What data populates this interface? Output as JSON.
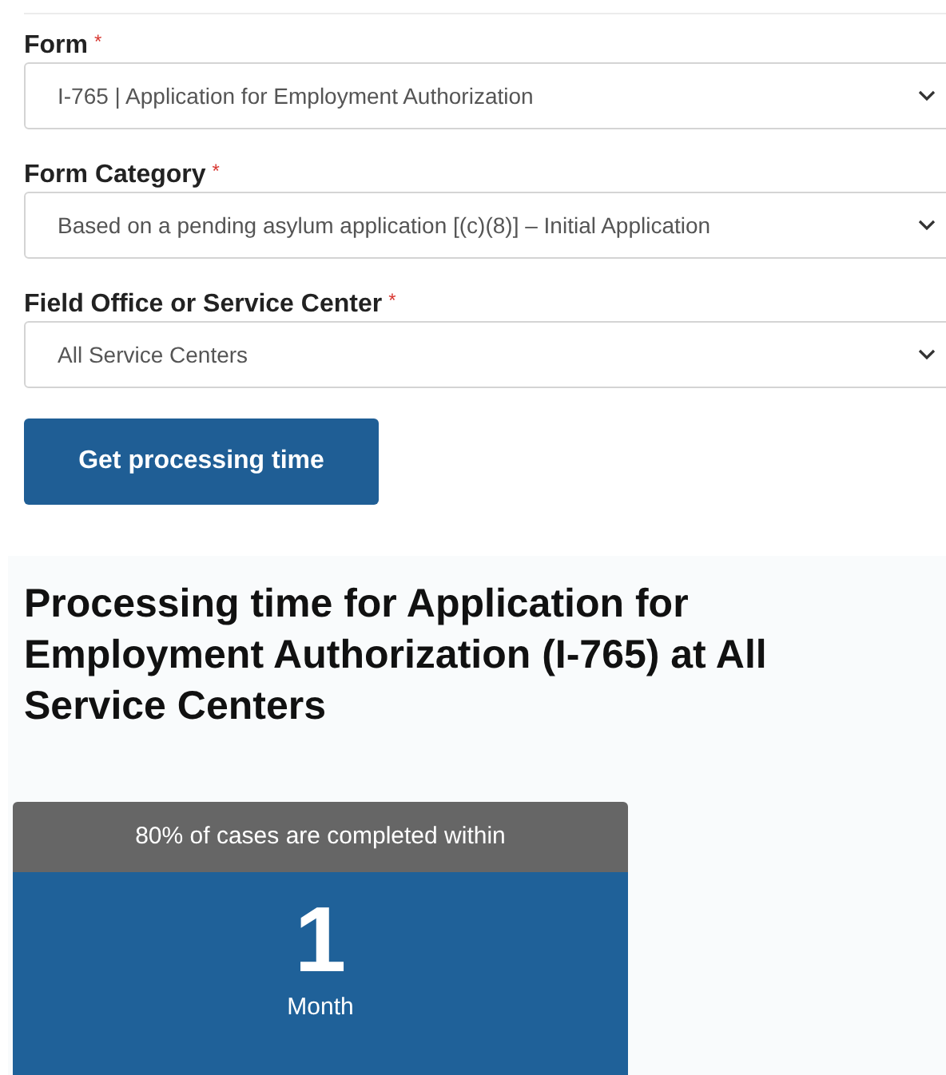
{
  "fields": [
    {
      "label": "Form",
      "required_mark": "*",
      "value": "I-765 | Application for Employment Authorization"
    },
    {
      "label": "Form Category",
      "required_mark": "*",
      "value": "Based on a pending asylum application [(c)(8)] – Initial Application"
    },
    {
      "label": "Field Office or Service Center",
      "required_mark": "*",
      "value": "All Service Centers"
    }
  ],
  "submit_button": "Get processing time",
  "result": {
    "heading": "Processing time for Application for Employment Authorization (I-765) at All Service Centers",
    "card": {
      "caption": "80% of cases are completed within",
      "number": "1",
      "unit": "Month"
    }
  }
}
